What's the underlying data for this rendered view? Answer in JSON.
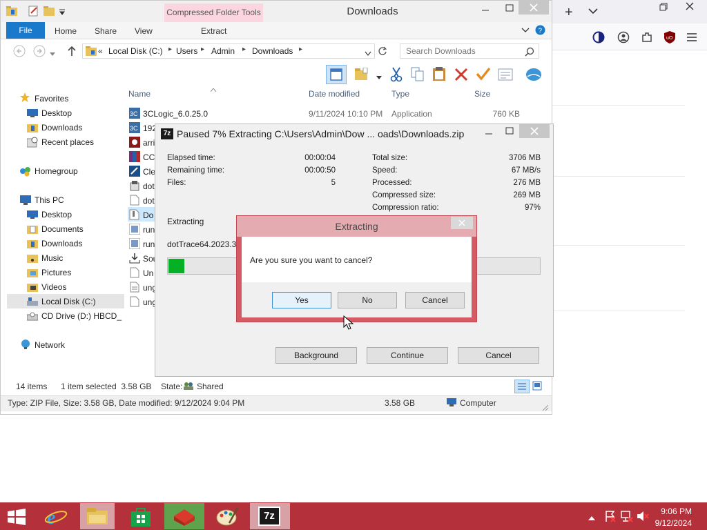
{
  "explorer": {
    "title": "Downloads",
    "context_tab": "Compressed Folder Tools",
    "tabs": [
      "File",
      "Home",
      "Share",
      "View",
      "Extract"
    ],
    "address": {
      "chevrons": "«",
      "parts": [
        "Local Disk (C:)",
        "Users",
        "Admin",
        "Downloads"
      ]
    },
    "search_placeholder": "Search Downloads",
    "columns": {
      "name": "Name",
      "date": "Date modified",
      "type": "Type",
      "size": "Size"
    },
    "nav": {
      "favorites": "Favorites",
      "fav_items": [
        "Desktop",
        "Downloads",
        "Recent places"
      ],
      "homegroup": "Homegroup",
      "thispc": "This PC",
      "pc_items": [
        "Desktop",
        "Documents",
        "Downloads",
        "Music",
        "Pictures",
        "Videos",
        "Local Disk (C:)",
        "CD Drive (D:) HBCD_"
      ],
      "network": "Network"
    },
    "files": [
      {
        "name": "3CLogic_6.0.25.0",
        "date": "9/11/2024 10:10 PM",
        "type": "Application",
        "size": "760 KB"
      },
      {
        "name": "192"
      },
      {
        "name": "arri"
      },
      {
        "name": "CC"
      },
      {
        "name": "Cle"
      },
      {
        "name": "dot"
      },
      {
        "name": "dot"
      },
      {
        "name": "Do"
      },
      {
        "name": "run"
      },
      {
        "name": "run"
      },
      {
        "name": "Sou"
      },
      {
        "name": "Un"
      },
      {
        "name": "ung"
      },
      {
        "name": "ung"
      }
    ],
    "status": {
      "items": "14 items",
      "selected": "1 item selected  3.58 GB",
      "state_label": "State:",
      "state_value": "Shared"
    },
    "details_bar": {
      "info": "Type: ZIP File, Size: 3.58 GB, Date modified: 9/12/2024 9:04 PM",
      "size": "3.58 GB",
      "location": "Computer"
    }
  },
  "zip_dialog": {
    "title": "Paused 7% Extracting C:\\Users\\Admin\\Dow ... oads\\Downloads.zip",
    "left_stats": [
      {
        "label": "Elapsed time:",
        "value": "00:00:04"
      },
      {
        "label": "Remaining time:",
        "value": "00:00:50"
      },
      {
        "label": "Files:",
        "value": "5"
      }
    ],
    "right_stats": [
      {
        "label": "Total size:",
        "value": "3706 MB"
      },
      {
        "label": "Speed:",
        "value": "67 MB/s"
      },
      {
        "label": "Processed:",
        "value": "276 MB"
      },
      {
        "label": "Compressed size:",
        "value": "269 MB"
      },
      {
        "label": "Compression ratio:",
        "value": "97%"
      }
    ],
    "status_label": "Extracting",
    "current_file": "dotTrace64.2023.3.3",
    "progress": 0.07,
    "buttons": {
      "background": "Background",
      "continue": "Continue",
      "cancel": "Cancel"
    }
  },
  "confirm_dialog": {
    "title": "Extracting",
    "message": "Are you sure you want to cancel?",
    "buttons": {
      "yes": "Yes",
      "no": "No",
      "cancel": "Cancel"
    }
  },
  "taskbar": {
    "time": "9:06 PM",
    "date": "9/12/2024"
  },
  "colors": {
    "taskbar": "#b4303b",
    "file_tab": "#1979ca",
    "progress": "#06b025",
    "confirm_border": "#d65a64"
  }
}
